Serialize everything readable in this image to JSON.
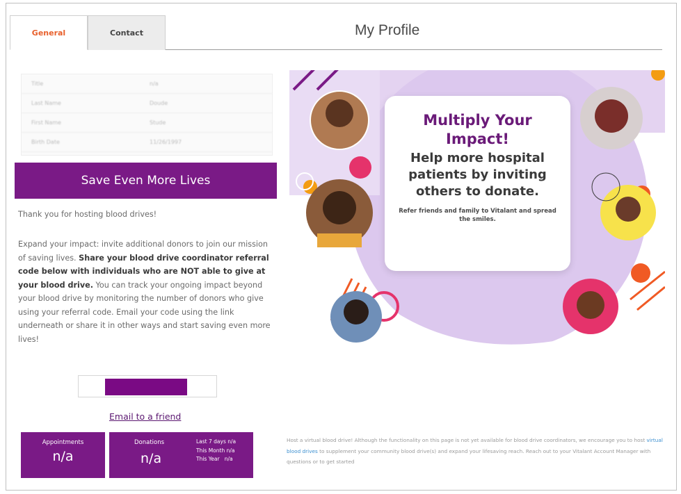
{
  "tabs": [
    {
      "label": "General",
      "active": true
    },
    {
      "label": "Contact",
      "active": false
    }
  ],
  "page_title": "My Profile",
  "profile_table": [
    {
      "label": "Title",
      "value": "n/a"
    },
    {
      "label": "Last Name",
      "value": "Doude"
    },
    {
      "label": "First Name",
      "value": "Stude"
    },
    {
      "label": "Birth Date",
      "value": "11/26/1997"
    }
  ],
  "banner_title": "Save Even More Lives",
  "thanks_text": "Thank you for hosting blood drives!",
  "body": {
    "part1": "Expand your impact: invite additional donors to join our mission of saving lives. ",
    "bold": "Share your blood drive coordinator referral code below with individuals who are NOT able to give at your blood drive.",
    "part2": " You can track your ongoing impact beyond your blood drive by monitoring the number of donors who give using your referral code. Email your code using the link underneath or share it in other ways and start saving even more lives!"
  },
  "email_link": "Email to a friend",
  "stats": {
    "appointments_label": "Appointments",
    "appointments_value": "n/a",
    "donations_label": "Donations",
    "donations_value": "n/a",
    "periods": [
      {
        "label": "Last 7 days",
        "value": "n/a"
      },
      {
        "label": "This Month",
        "value": "n/a"
      },
      {
        "label": "This Year",
        "value": "n/a"
      }
    ]
  },
  "promo": {
    "title": "Multiply Your Impact!",
    "subtitle": "Help more hospital patients by inviting others to donate.",
    "small": "Refer friends and family to Vitalant and spread the smiles."
  },
  "footnote": {
    "part1": "Host a virtual blood drive! Although the functionality on this page is not yet available for blood drive coordinators, we encourage you to host ",
    "link": "virtual blood drives",
    "part2": " to supplement your community blood drive(s) and expand your lifesaving reach. Reach out to your Vitalant Account Manager with questions or to get started"
  },
  "colors": {
    "brand_purple": "#7a1a86",
    "tab_active": "#e8602c",
    "accent_orange": "#f05a24",
    "accent_pink": "#e5336b",
    "lavender": "#dcc8ee"
  }
}
